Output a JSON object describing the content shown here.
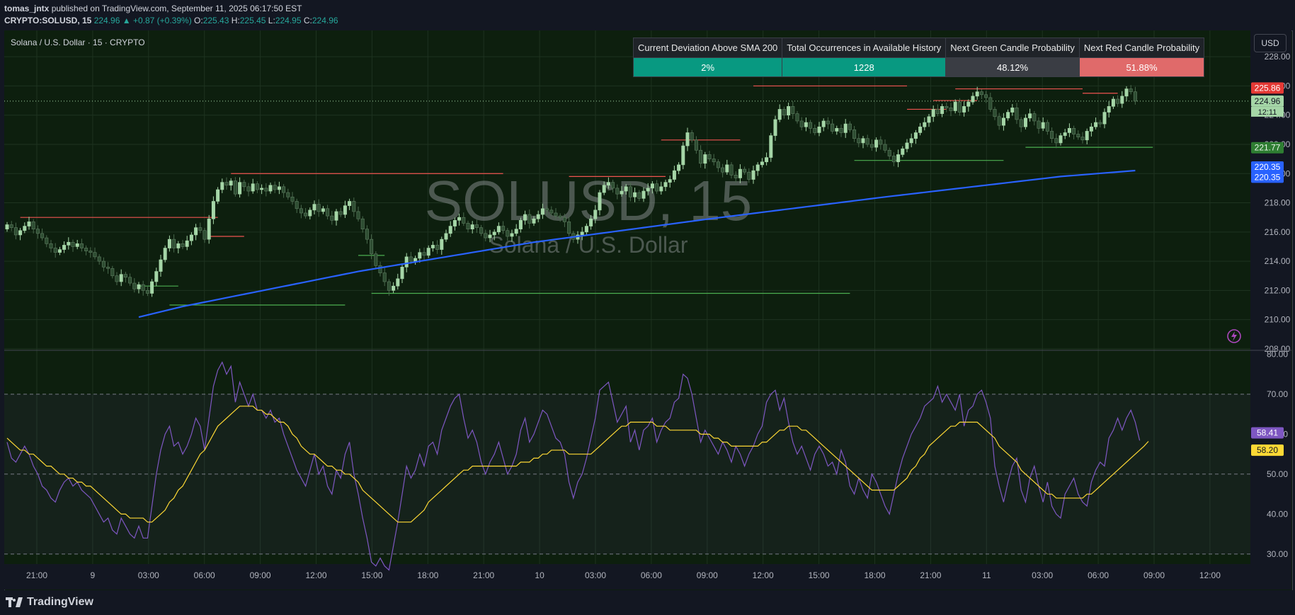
{
  "header": {
    "author": "tomas_jntx",
    "published_text": "published on TradingView.com, September 11, 2025 06:17:50 EST",
    "symbol": "CRYPTO:SOLUSD, 15",
    "last": "224.96",
    "change": "▲ +0.87 (+0.39%)",
    "o_label": "O:",
    "o": "225.43",
    "h_label": "H:",
    "h": "225.45",
    "l_label": "L:",
    "l": "224.95",
    "c_label": "C:",
    "c": "224.96"
  },
  "chart_title": "Solana / U.S. Dollar · 15 · CRYPTO",
  "watermark": {
    "symbol": "SOLUSD, 15",
    "name": "Solana / U.S. Dollar"
  },
  "currency_button": "USD",
  "stats_table": {
    "headers": [
      "Current Deviation Above SMA 200",
      "Total Occurrences in Available History",
      "Next Green Candle Probability",
      "Next Red Candle Probability"
    ],
    "values": [
      "2%",
      "1228",
      "48.12%",
      "51.88%"
    ]
  },
  "footer": {
    "brand": "TradingView"
  },
  "colors": {
    "background": "#0d1f0e",
    "sma": "#2962ff",
    "rsi": "#7e57c2",
    "rsi_ma": "#fdd835",
    "up": "#a5d6a7",
    "down": "#2e4d32",
    "res": "#ef5350",
    "sup": "#4caf50"
  },
  "chart_data": [
    {
      "type": "candlestick",
      "price_axis": {
        "ticks": [
          "228.00",
          "226.00",
          "224.00",
          "222.00",
          "220.00",
          "218.00",
          "216.00",
          "214.00",
          "212.00",
          "210.00",
          "208.00"
        ],
        "range": [
          207.9,
          229.8
        ]
      },
      "time_axis": {
        "ticks": [
          "21:00",
          "9",
          "03:00",
          "06:00",
          "09:00",
          "12:00",
          "15:00",
          "18:00",
          "21:00",
          "10",
          "03:00",
          "06:00",
          "09:00",
          "12:00",
          "15:00",
          "18:00",
          "21:00",
          "11",
          "03:00",
          "06:00",
          "09:00",
          "12:00"
        ]
      },
      "close": [
        216.5,
        216.3,
        215.8,
        216.1,
        216.4,
        216.7,
        216.2,
        215.9,
        215.6,
        215.2,
        214.9,
        214.6,
        214.8,
        215.1,
        215.3,
        215.0,
        215.2,
        214.9,
        214.7,
        214.6,
        214.3,
        214.0,
        213.6,
        213.5,
        213.0,
        212.6,
        213.1,
        212.9,
        212.5,
        212.1,
        212.4,
        212.0,
        211.8,
        212.6,
        213.3,
        214.1,
        214.9,
        215.5,
        214.9,
        215.2,
        215.0,
        215.4,
        215.8,
        216.3,
        216.1,
        215.5,
        216.9,
        218.1,
        218.9,
        219.4,
        219.2,
        219.5,
        218.6,
        219.4,
        219.1,
        218.8,
        219.3,
        218.9,
        219.0,
        218.8,
        219.2,
        218.9,
        219.1,
        218.7,
        218.4,
        218.1,
        217.6,
        217.3,
        217.1,
        217.5,
        217.9,
        217.4,
        217.6,
        217.1,
        216.8,
        217.4,
        217.2,
        217.8,
        218.1,
        217.4,
        216.9,
        216.2,
        215.5,
        214.5,
        213.7,
        213.2,
        212.6,
        212.0,
        212.3,
        212.8,
        213.6,
        214.3,
        214.0,
        214.2,
        214.6,
        214.4,
        214.9,
        215.1,
        214.8,
        215.5,
        215.9,
        216.4,
        216.8,
        217.0,
        216.6,
        216.2,
        216.5,
        216.3,
        215.9,
        215.6,
        215.8,
        216.0,
        216.4,
        216.1,
        215.7,
        215.9,
        216.2,
        216.8,
        217.2,
        216.6,
        216.9,
        217.2,
        217.6,
        217.5,
        217.3,
        217.1,
        217.0,
        216.7,
        215.9,
        215.5,
        215.8,
        216.0,
        216.4,
        216.9,
        217.5,
        218.7,
        219.2,
        219.4,
        219.0,
        218.6,
        218.8,
        219.1,
        218.4,
        218.7,
        218.3,
        218.8,
        219.0,
        219.3,
        218.8,
        219.1,
        219.4,
        219.6,
        220.2,
        220.6,
        221.9,
        222.8,
        222.3,
        221.6,
        220.7,
        221.3,
        221.0,
        220.8,
        220.4,
        220.1,
        220.6,
        219.9,
        219.7,
        220.3,
        220.1,
        219.6,
        220.2,
        220.6,
        220.8,
        221.1,
        222.6,
        223.7,
        224.4,
        224.0,
        224.6,
        224.1,
        223.6,
        223.2,
        223.5,
        223.1,
        222.8,
        223.2,
        223.6,
        223.4,
        222.9,
        223.1,
        222.8,
        223.4,
        223.0,
        222.4,
        222.1,
        222.4,
        222.0,
        221.8,
        222.3,
        222.0,
        221.6,
        221.2,
        220.8,
        221.3,
        221.7,
        222.1,
        222.4,
        222.8,
        223.2,
        223.5,
        223.9,
        224.4,
        224.1,
        224.6,
        224.5,
        224.3,
        224.9,
        224.2,
        224.6,
        224.9,
        225.3,
        225.6,
        225.4,
        225.2,
        224.4,
        223.9,
        223.3,
        223.8,
        224.2,
        224.5,
        223.7,
        223.2,
        223.8,
        224.1,
        223.6,
        223.1,
        223.5,
        222.9,
        222.4,
        222.1,
        222.6,
        222.8,
        223.1,
        222.7,
        222.5,
        222.3,
        222.9,
        223.2,
        223.5,
        223.4,
        224.2,
        224.6,
        225.1,
        224.8,
        225.3,
        225.8,
        225.6,
        224.96
      ],
      "series": [
        {
          "name": "SMA 200",
          "x": [
            0,
            40,
            80,
            120,
            160,
            200,
            240,
            263
          ],
          "values": [
            208.0,
            210.9,
            213.3,
            215.3,
            216.9,
            218.4,
            219.8,
            220.35
          ]
        }
      ],
      "last_price_labels": [
        "225.86",
        "224.96",
        "12:11",
        "221.77",
        "220.35",
        "220.35"
      ],
      "resistance": [
        {
          "price": 217.0,
          "x": [
            3,
            48
          ]
        },
        {
          "price": 215.7,
          "x": [
            46,
            54
          ]
        },
        {
          "price": 220.0,
          "x": [
            51,
            113
          ]
        },
        {
          "price": 219.8,
          "x": [
            128,
            150
          ]
        },
        {
          "price": 222.3,
          "x": [
            149,
            167
          ]
        },
        {
          "price": 226.0,
          "x": [
            170,
            205
          ]
        },
        {
          "price": 224.4,
          "x": [
            205,
            214
          ]
        },
        {
          "price": 225.0,
          "x": [
            211,
            221
          ]
        },
        {
          "price": 225.8,
          "x": [
            216,
            245
          ]
        },
        {
          "price": 225.5,
          "x": [
            245,
            253
          ]
        }
      ],
      "support": [
        {
          "price": 211.0,
          "x": [
            37,
            77
          ]
        },
        {
          "price": 212.3,
          "x": [
            30,
            39
          ]
        },
        {
          "price": 214.4,
          "x": [
            80,
            86
          ]
        },
        {
          "price": 211.8,
          "x": [
            83,
            192
          ]
        },
        {
          "price": 220.9,
          "x": [
            193,
            227
          ]
        },
        {
          "price": 221.8,
          "x": [
            232,
            261
          ]
        }
      ]
    },
    {
      "type": "line",
      "rsi_axis": {
        "ticks": [
          "80.00",
          "70.00",
          "60.00",
          "50.00",
          "40.00",
          "30.00"
        ],
        "range": [
          27.5,
          80.8
        ],
        "band": [
          30,
          70
        ]
      },
      "series": [
        {
          "name": "RSI",
          "values": [
            58,
            54,
            53,
            55,
            57,
            55,
            52,
            50,
            47,
            46,
            44,
            43,
            46,
            48,
            49,
            47,
            48,
            46,
            45,
            44,
            42,
            40,
            38,
            39,
            36,
            35,
            39,
            37,
            35,
            34,
            37,
            34,
            34,
            42,
            50,
            56,
            60,
            62,
            57,
            58,
            55,
            57,
            60,
            64,
            62,
            56,
            64,
            72,
            76,
            78,
            75,
            77,
            68,
            73,
            70,
            67,
            70,
            66,
            66,
            64,
            66,
            63,
            64,
            60,
            57,
            54,
            51,
            49,
            47,
            51,
            55,
            50,
            52,
            47,
            45,
            51,
            49,
            55,
            58,
            50,
            45,
            39,
            34,
            28,
            27,
            29,
            27,
            26,
            32,
            38,
            45,
            52,
            49,
            51,
            55,
            52,
            57,
            58,
            55,
            61,
            64,
            67,
            69,
            70,
            64,
            59,
            61,
            58,
            53,
            50,
            53,
            55,
            58,
            54,
            50,
            52,
            55,
            61,
            64,
            58,
            60,
            63,
            66,
            65,
            62,
            59,
            58,
            55,
            48,
            44,
            48,
            50,
            54,
            59,
            64,
            71,
            72,
            73,
            68,
            63,
            65,
            67,
            58,
            61,
            56,
            61,
            62,
            64,
            58,
            61,
            63,
            64,
            68,
            69,
            75,
            74,
            70,
            64,
            58,
            61,
            59,
            57,
            55,
            58,
            56,
            53,
            57,
            55,
            52,
            55,
            57,
            60,
            62,
            68,
            70,
            71,
            66,
            69,
            63,
            58,
            55,
            57,
            54,
            51,
            55,
            57,
            55,
            52,
            53,
            50,
            56,
            53,
            47,
            45,
            49,
            46,
            44,
            50,
            48,
            45,
            42,
            40,
            45,
            50,
            54,
            57,
            60,
            62,
            64,
            67,
            68,
            69,
            72,
            68,
            70,
            68,
            66,
            70,
            62,
            66,
            67,
            70,
            71,
            68,
            64,
            52,
            47,
            43,
            48,
            52,
            54,
            46,
            43,
            49,
            52,
            47,
            43,
            48,
            42,
            40,
            39,
            45,
            47,
            49,
            45,
            43,
            42,
            48,
            51,
            53,
            52,
            59,
            61,
            64,
            61,
            64,
            66,
            63,
            58.41
          ]
        },
        {
          "name": "RSI-based MA",
          "values": [
            59,
            58,
            57,
            56,
            56,
            55,
            55,
            54,
            53,
            52,
            52,
            51,
            50,
            50,
            49,
            49,
            48,
            48,
            47,
            47,
            46,
            45,
            44,
            43,
            42,
            41,
            40,
            40,
            39,
            39,
            39,
            39,
            38,
            38,
            39,
            40,
            41,
            43,
            44,
            46,
            47,
            49,
            51,
            53,
            55,
            56,
            58,
            60,
            62,
            63,
            64,
            65,
            66,
            67,
            67,
            67,
            67,
            66,
            66,
            65,
            65,
            64,
            63,
            63,
            62,
            60,
            59,
            57,
            56,
            55,
            55,
            54,
            53,
            52,
            52,
            51,
            51,
            50,
            50,
            49,
            48,
            46,
            45,
            44,
            43,
            42,
            41,
            40,
            39,
            38,
            38,
            38,
            38,
            39,
            40,
            41,
            43,
            44,
            45,
            46,
            47,
            48,
            49,
            50,
            51,
            51,
            52,
            52,
            52,
            52,
            52,
            52,
            52,
            52,
            52,
            52,
            52,
            53,
            53,
            53,
            54,
            54,
            55,
            55,
            56,
            56,
            56,
            56,
            55,
            55,
            55,
            55,
            55,
            55,
            56,
            57,
            58,
            59,
            60,
            61,
            62,
            62,
            63,
            63,
            63,
            63,
            63,
            63,
            62,
            62,
            62,
            61,
            61,
            61,
            61,
            61,
            61,
            61,
            60,
            60,
            60,
            59,
            59,
            58,
            58,
            57,
            57,
            57,
            57,
            57,
            57,
            57,
            58,
            58,
            59,
            60,
            61,
            61,
            62,
            62,
            62,
            61,
            61,
            60,
            59,
            58,
            57,
            56,
            55,
            54,
            53,
            52,
            51,
            50,
            49,
            48,
            47,
            46,
            46,
            46,
            46,
            46,
            46,
            47,
            48,
            49,
            51,
            52,
            54,
            55,
            57,
            58,
            59,
            60,
            61,
            62,
            62,
            63,
            63,
            63,
            63,
            63,
            62,
            61,
            60,
            59,
            57,
            56,
            55,
            54,
            53,
            51,
            50,
            49,
            48,
            47,
            46,
            45,
            45,
            44,
            44,
            44,
            44,
            44,
            44,
            44,
            45,
            45,
            46,
            47,
            48,
            49,
            50,
            51,
            52,
            53,
            54,
            55,
            56,
            57,
            58.2
          ]
        }
      ],
      "last_labels": [
        "58.41",
        "58.20"
      ]
    }
  ]
}
